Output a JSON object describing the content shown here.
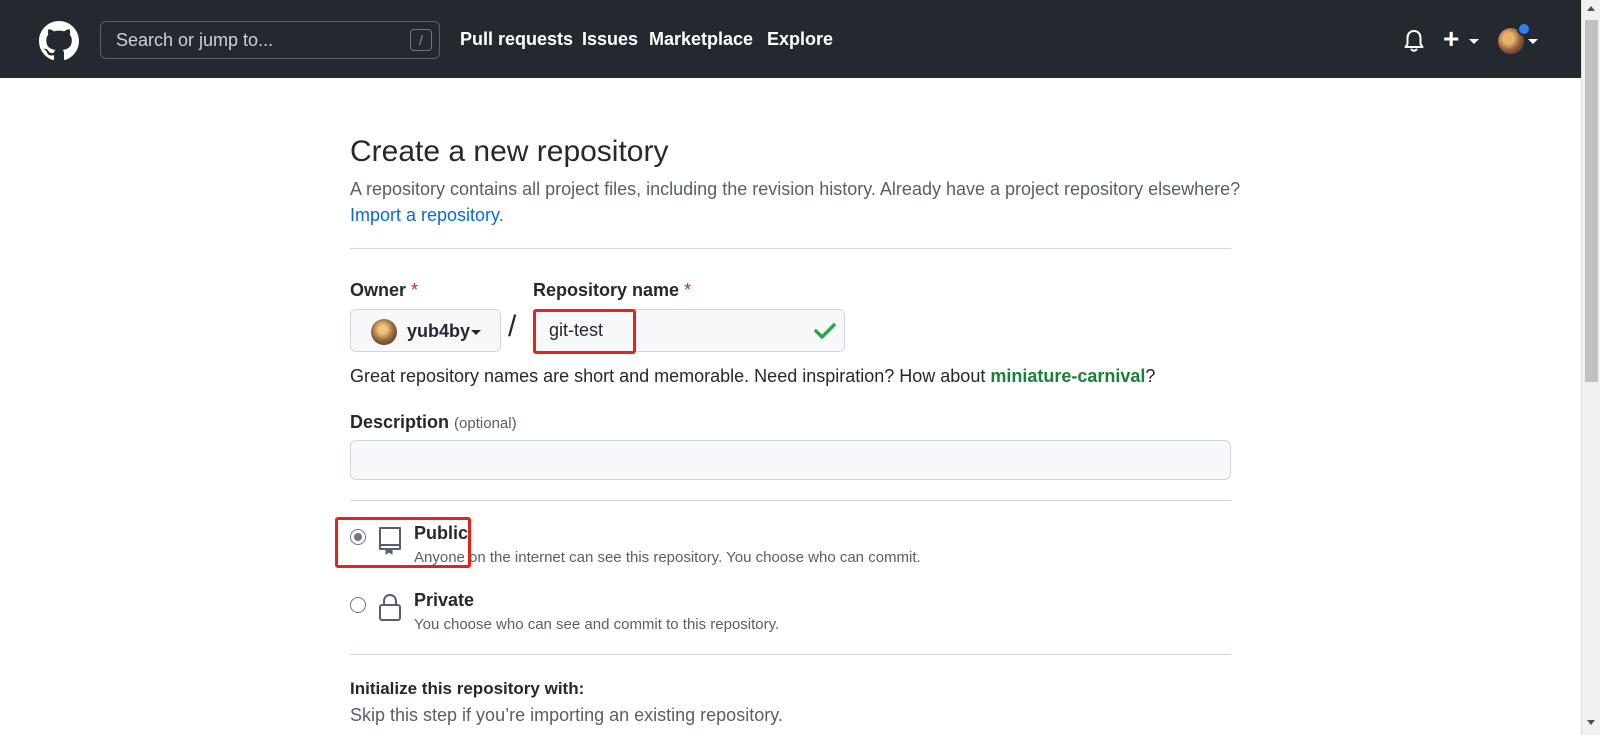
{
  "header": {
    "search": {
      "placeholder": "Search or jump to...",
      "shortcut": "/"
    },
    "nav": [
      "Pull requests",
      "Issues",
      "Marketplace",
      "Explore"
    ],
    "icons": [
      "github-logo-icon",
      "bell-icon",
      "plus-icon",
      "avatar"
    ]
  },
  "page": {
    "title": "Create a new repository",
    "subtitle": "A repository contains all project files, including the revision history. Already have a project repository elsewhere?",
    "import_link": "Import a repository."
  },
  "form": {
    "owner_label": "Owner",
    "required_mark": "*",
    "owner_value": "yub4by",
    "separator": "/",
    "repo_label": "Repository name",
    "repo_value": "git-test",
    "hint_prefix": "Great repository names are short and memorable. Need inspiration? How about ",
    "hint_suggestion": "miniature-carnival",
    "hint_suffix": "?",
    "description_label": "Description",
    "description_optional": "(optional)",
    "description_value": "",
    "visibility": [
      {
        "label": "Public",
        "desc": "Anyone on the internet can see this repository. You choose who can commit.",
        "selected": true
      },
      {
        "label": "Private",
        "desc": "You choose who can see and commit to this repository.",
        "selected": false
      }
    ],
    "init_title": "Initialize this repository with:",
    "init_desc": "Skip this step if you’re importing an existing repository."
  },
  "colors": {
    "header_bg": "#24292f",
    "link": "#0969da",
    "suggestion": "#1a7f37",
    "required": "#cf222e",
    "highlight_box": "#e3231c",
    "valid_check": "#2da44e"
  }
}
